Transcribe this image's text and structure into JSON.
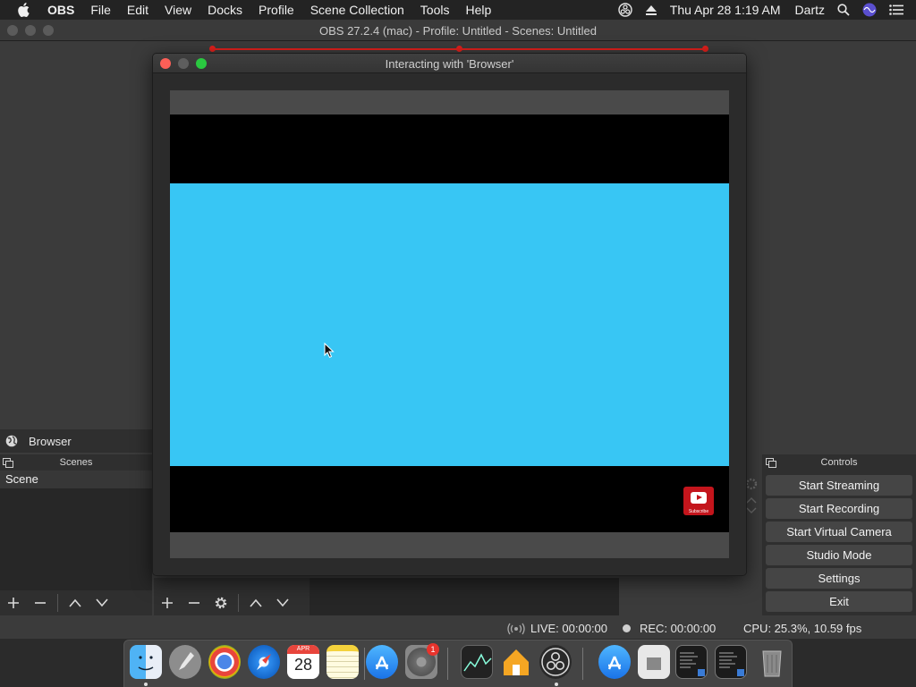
{
  "menubar": {
    "app_name": "OBS",
    "items": [
      "File",
      "Edit",
      "View",
      "Docks",
      "Profile",
      "Scene Collection",
      "Tools",
      "Help"
    ],
    "clock": "Thu Apr 28  1:19 AM",
    "user": "Dartz"
  },
  "obs_window": {
    "title": "OBS 27.2.4 (mac) - Profile: Untitled - Scenes: Untitled"
  },
  "interact_window": {
    "title": "Interacting with 'Browser'",
    "subscribe_text": "Subscribe",
    "colors": {
      "content_blue": "#38c6f4",
      "band_black": "#000000",
      "subscribe_red": "#c4151c"
    }
  },
  "source_bar": {
    "label": "Browser"
  },
  "scenes": {
    "header": "Scenes",
    "items": [
      "Scene"
    ]
  },
  "controls": {
    "header": "Controls",
    "buttons": [
      "Start Streaming",
      "Start Recording",
      "Start Virtual Camera",
      "Studio Mode",
      "Settings",
      "Exit"
    ]
  },
  "statusbar": {
    "live": "LIVE: 00:00:00",
    "rec": "REC: 00:00:00",
    "cpu": "CPU: 25.3%, 10.59 fps"
  },
  "dock": {
    "calendar_month": "APR",
    "calendar_day": "28",
    "settings_badge": "1"
  }
}
